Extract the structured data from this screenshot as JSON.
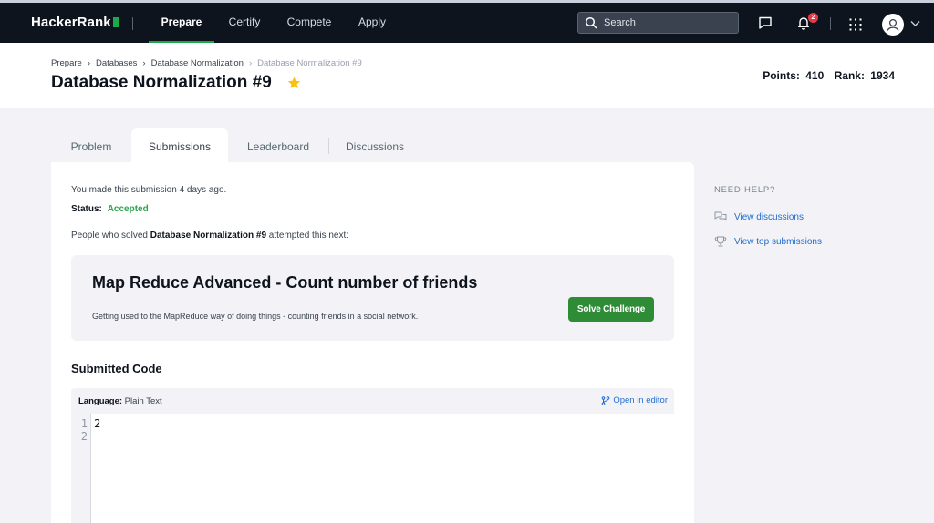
{
  "nav": {
    "logo": "HackerRank",
    "links": [
      "Prepare",
      "Certify",
      "Compete",
      "Apply"
    ],
    "search_placeholder": "Search",
    "notification_count": "2"
  },
  "breadcrumb": [
    "Prepare",
    "Databases",
    "Database Normalization",
    "Database Normalization #9"
  ],
  "page": {
    "title": "Database Normalization #9",
    "points_label": "Points:",
    "points": "410",
    "rank_label": "Rank:",
    "rank": "1934"
  },
  "tabs": [
    "Problem",
    "Submissions",
    "Leaderboard",
    "Discussions"
  ],
  "submission": {
    "made_text": "You made this submission 4 days ago.",
    "status_label": "Status:",
    "status": "Accepted",
    "next_prefix": "People who solved",
    "next_challenge_name": "Database Normalization #9",
    "next_suffix": "attempted this next:"
  },
  "challenge": {
    "title": "Map Reduce Advanced - Count number of friends",
    "description": "Getting used to the MapReduce way of doing things - counting friends in a social network.",
    "button": "Solve Challenge"
  },
  "code": {
    "heading": "Submitted Code",
    "language_label": "Language:",
    "language": "Plain Text",
    "open_editor": "Open in editor",
    "line_numbers": [
      "1",
      "2"
    ],
    "lines": [
      "2"
    ]
  },
  "help": {
    "heading": "NEED HELP?",
    "view_discussions": "View discussions",
    "view_top_submissions": "View top submissions"
  },
  "colors": {
    "nav_bg": "#0e141e",
    "accent_green": "#1ba94c",
    "accepted": "#2ea44f",
    "solve_button": "#2e8b36",
    "link_blue": "#1f6cd0"
  }
}
